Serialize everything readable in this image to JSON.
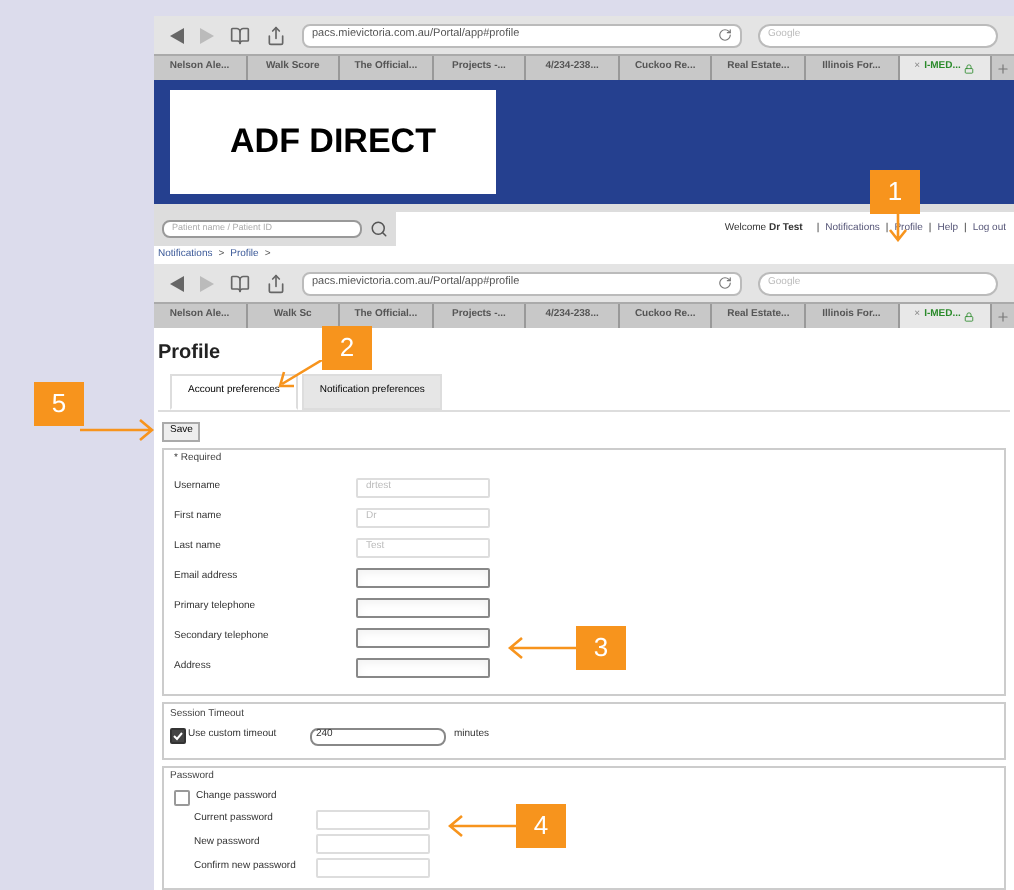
{
  "browser_bars": [
    {
      "url": "pacs.mievictoria.com.au/Portal/app#profile",
      "search_placeholder": "Google",
      "tabs": [
        {
          "label": "Nelson Ale...",
          "selected": false
        },
        {
          "label": "Walk Score",
          "selected": false
        },
        {
          "label": "The Official...",
          "selected": false
        },
        {
          "label": "Projects -...",
          "selected": false
        },
        {
          "label": "4/234-238...",
          "selected": false
        },
        {
          "label": "Cuckoo Re...",
          "selected": false
        },
        {
          "label": "Real Estate...",
          "selected": false
        },
        {
          "label": "Illinois For...",
          "selected": false
        },
        {
          "label": "I-MED...",
          "selected": true,
          "close": "×"
        }
      ]
    },
    {
      "url": "pacs.mievictoria.com.au/Portal/app#profile",
      "search_placeholder": "Google",
      "tabs": [
        {
          "label": "Nelson Ale...",
          "selected": false
        },
        {
          "label": "Walk Sc",
          "selected": false
        },
        {
          "label": "The Official...",
          "selected": false
        },
        {
          "label": "Projects -...",
          "selected": false
        },
        {
          "label": "4/234-238...",
          "selected": false
        },
        {
          "label": "Cuckoo Re...",
          "selected": false
        },
        {
          "label": "Real Estate...",
          "selected": false
        },
        {
          "label": "Illinois For...",
          "selected": false
        },
        {
          "label": "I-MED...",
          "selected": true,
          "close": "×"
        }
      ]
    }
  ],
  "header": {
    "logo": "ADF DIRECT"
  },
  "toolbar": {
    "search_placeholder": "Patient name / Patient ID",
    "welcome": "Welcome **Dr Test**",
    "links": [
      "Notifications",
      "Profile",
      "Help",
      "Log out"
    ],
    "separator": "|"
  },
  "breadcrumb": {
    "items": [
      "Notifications",
      "Profile"
    ],
    "separator": ">"
  },
  "page_title": "Profile",
  "tabs": [
    {
      "label": "Account preferences",
      "selected": true
    },
    {
      "label": "Notification preferences",
      "selected": false
    }
  ],
  "save_button": "Save",
  "required_section": {
    "legend": "* Required",
    "fields": [
      {
        "label": "Username",
        "value": "drtest",
        "disabled": true
      },
      {
        "label": "First name",
        "value": "Dr",
        "disabled": true
      },
      {
        "label": "Last name",
        "value": "Test",
        "disabled": true
      },
      {
        "label": "Email address",
        "disabled": false
      },
      {
        "label": "Primary telephone",
        "disabled": false
      },
      {
        "label": "Secondary telephone",
        "disabled": false
      },
      {
        "label": "Address",
        "disabled": false
      }
    ]
  },
  "session_timeout": {
    "legend": "Session Timeout",
    "checkbox": {
      "label": "Use custom timeout",
      "checked": true
    },
    "value": "240",
    "unit": "minutes"
  },
  "password": {
    "legend": "Password",
    "checkbox": {
      "label": "Change password",
      "checked": false
    },
    "fields": [
      {
        "label": "Current password",
        "disabled": true
      },
      {
        "label": "New password",
        "disabled": true
      },
      {
        "label": "Confirm new password",
        "disabled": true
      }
    ]
  },
  "annotations": [
    {
      "number": "1"
    },
    {
      "number": "2"
    },
    {
      "number": "3"
    },
    {
      "number": "4"
    },
    {
      "number": "5"
    }
  ]
}
